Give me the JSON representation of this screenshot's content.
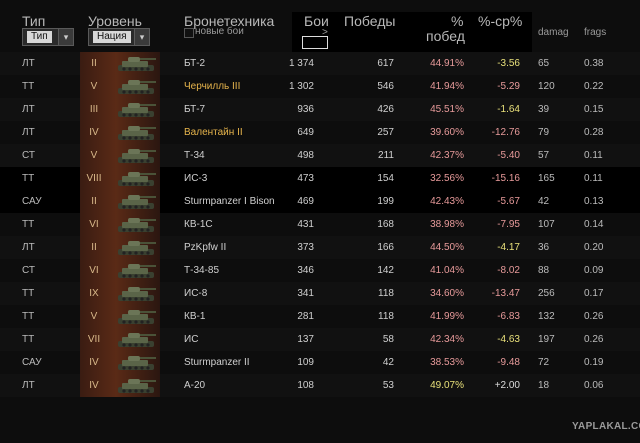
{
  "header": {
    "col_type": "Тип",
    "col_level": "Уровень",
    "col_vehicle": "Бронетехника",
    "col_battles": "Бои",
    "col_battles_arrow": ">",
    "col_wins": "Победы",
    "col_pct_top": "%",
    "col_pct_bottom": "побед",
    "col_diff": "%-ср%",
    "col_damage": "damag",
    "col_frags": "frags",
    "new_battles_label": "новые бои",
    "type_filter_value": "Тип",
    "nation_filter_value": "Нация"
  },
  "rows": [
    {
      "type": "ЛТ",
      "level": "II",
      "name": "БТ-2",
      "battles": "1 374",
      "wins": "617",
      "pct": "44.91%",
      "diff": "-3.56",
      "damage": "65",
      "frags": "0.38"
    },
    {
      "type": "ТТ",
      "level": "V",
      "name": "Черчилль III",
      "battles": "1 302",
      "wins": "546",
      "pct": "41.94%",
      "diff": "-5.29",
      "damage": "120",
      "frags": "0.22"
    },
    {
      "type": "ЛТ",
      "level": "III",
      "name": "БТ-7",
      "battles": "936",
      "wins": "426",
      "pct": "45.51%",
      "diff": "-1.64",
      "damage": "39",
      "frags": "0.15"
    },
    {
      "type": "ЛТ",
      "level": "IV",
      "name": "Валентайн II",
      "battles": "649",
      "wins": "257",
      "pct": "39.60%",
      "diff": "-12.76",
      "damage": "79",
      "frags": "0.28"
    },
    {
      "type": "СТ",
      "level": "V",
      "name": "Т-34",
      "battles": "498",
      "wins": "211",
      "pct": "42.37%",
      "diff": "-5.40",
      "damage": "57",
      "frags": "0.11"
    },
    {
      "type": "ТТ",
      "level": "VIII",
      "name": "ИС-3",
      "battles": "473",
      "wins": "154",
      "pct": "32.56%",
      "diff": "-15.16",
      "damage": "165",
      "frags": "0.11"
    },
    {
      "type": "САУ",
      "level": "II",
      "name": "Sturmpanzer I Bison",
      "battles": "469",
      "wins": "199",
      "pct": "42.43%",
      "diff": "-5.67",
      "damage": "42",
      "frags": "0.13"
    },
    {
      "type": "ТТ",
      "level": "VI",
      "name": "КВ-1С",
      "battles": "431",
      "wins": "168",
      "pct": "38.98%",
      "diff": "-7.95",
      "damage": "107",
      "frags": "0.14"
    },
    {
      "type": "ЛТ",
      "level": "II",
      "name": "PzKpfw II",
      "battles": "373",
      "wins": "166",
      "pct": "44.50%",
      "diff": "-4.17",
      "damage": "36",
      "frags": "0.20"
    },
    {
      "type": "СТ",
      "level": "VI",
      "name": "Т-34-85",
      "battles": "346",
      "wins": "142",
      "pct": "41.04%",
      "diff": "-8.02",
      "damage": "88",
      "frags": "0.09"
    },
    {
      "type": "ТТ",
      "level": "IX",
      "name": "ИС-8",
      "battles": "341",
      "wins": "118",
      "pct": "34.60%",
      "diff": "-13.47",
      "damage": "256",
      "frags": "0.17"
    },
    {
      "type": "ТТ",
      "level": "V",
      "name": "КВ-1",
      "battles": "281",
      "wins": "118",
      "pct": "41.99%",
      "diff": "-6.83",
      "damage": "132",
      "frags": "0.26"
    },
    {
      "type": "ТТ",
      "level": "VII",
      "name": "ИС",
      "battles": "137",
      "wins": "58",
      "pct": "42.34%",
      "diff": "-4.63",
      "damage": "197",
      "frags": "0.26"
    },
    {
      "type": "САУ",
      "level": "IV",
      "name": "Sturmpanzer II",
      "battles": "109",
      "wins": "42",
      "pct": "38.53%",
      "diff": "-9.48",
      "damage": "72",
      "frags": "0.19"
    },
    {
      "type": "ЛТ",
      "level": "IV",
      "name": "A-20",
      "battles": "108",
      "wins": "53",
      "pct": "49.07%",
      "diff": "+2.00",
      "damage": "18",
      "frags": "0.06"
    }
  ],
  "watermark": "YAPLAKAL.COM",
  "colors": {
    "gold_name": "#e6b44c",
    "bad_pct": "#e79a9a",
    "good_pct": "#e8e07a",
    "level_text": "#d9b98a"
  }
}
